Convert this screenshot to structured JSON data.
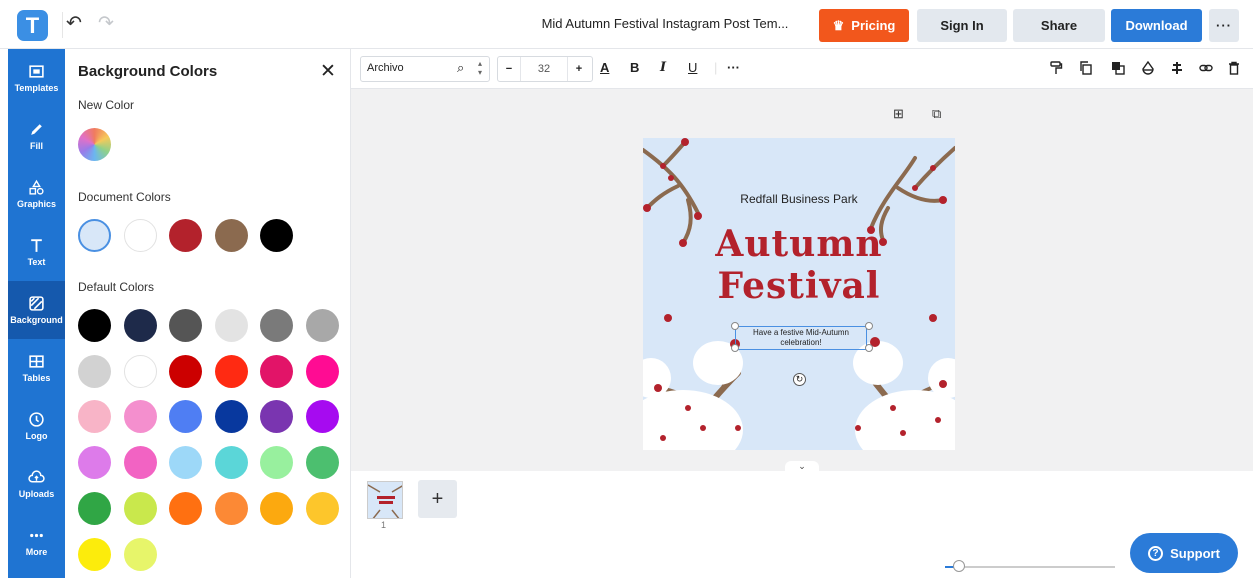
{
  "header": {
    "logo_letter": "T",
    "document_title": "Mid Autumn Festival Instagram Post Tem...",
    "buttons": {
      "pricing": "Pricing",
      "sign_in": "Sign In",
      "share": "Share",
      "download": "Download",
      "more": "···"
    }
  },
  "sidebar": {
    "items": [
      {
        "label": "Templates",
        "icon": "templates-icon"
      },
      {
        "label": "Fill",
        "icon": "pencil-icon"
      },
      {
        "label": "Graphics",
        "icon": "shapes-icon"
      },
      {
        "label": "Text",
        "icon": "text-icon"
      },
      {
        "label": "Background",
        "icon": "background-icon",
        "active": true
      },
      {
        "label": "Tables",
        "icon": "table-icon"
      },
      {
        "label": "Logo",
        "icon": "logo-icon"
      },
      {
        "label": "Uploads",
        "icon": "upload-cloud-icon"
      },
      {
        "label": "More",
        "icon": "more-dots-icon"
      }
    ]
  },
  "panel": {
    "title": "Background Colors",
    "new_color_label": "New Color",
    "document_colors_label": "Document Colors",
    "default_colors_label": "Default Colors",
    "document_colors": [
      "#d8e7f8",
      "#ffffff",
      "#b3222c",
      "#8b6a4f",
      "#000000"
    ],
    "default_colors": [
      "#000000",
      "#1e2a4a",
      "#555555",
      "#e3e3e3",
      "#7a7a7a",
      "#a8a8a8",
      "#d2d2d2",
      "#ffffff",
      "#cc0000",
      "#ff2a12",
      "#e21468",
      "#ff0c93",
      "#f8b4c7",
      "#f48fce",
      "#4f7ef3",
      "#08389e",
      "#7a35b0",
      "#a60bf0",
      "#dd7bea",
      "#f263c3",
      "#9dd8f8",
      "#5bd6d8",
      "#98f09e",
      "#4cbf6f",
      "#30a645",
      "#c9e84c",
      "#ff7011",
      "#fc8935",
      "#fca90f",
      "#fdc62b",
      "#fcec0c",
      "#e7f56a"
    ]
  },
  "toolbar": {
    "font_name": "Archivo",
    "font_size": "32",
    "more": "···"
  },
  "design": {
    "venue": "Redfall Business Park",
    "headline_line1": "Autumn",
    "headline_line2": "Festival",
    "subtitle": "Have a festive Mid-Autumn celebration!"
  },
  "pages": {
    "current_page_number": "1",
    "add_page": "+"
  },
  "support": {
    "label": "Support"
  },
  "colors": {
    "brand_blue": "#1f74d2",
    "pricing_orange": "#f2571c",
    "headline_red": "#b3222c",
    "post_background": "#d8e7f8"
  }
}
